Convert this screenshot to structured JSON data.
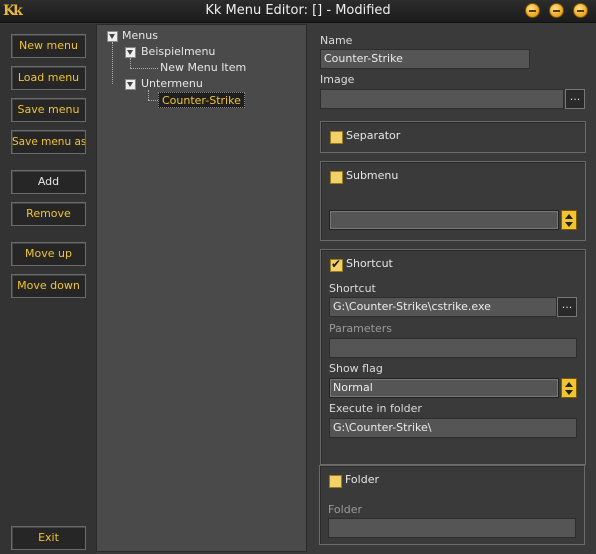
{
  "window": {
    "title": "Kk Menu Editor: [] - Modified",
    "logo": "Kk",
    "controls": [
      "minimize-icon",
      "maximize-icon",
      "close-icon"
    ]
  },
  "sidebar": {
    "new_menu": "New menu",
    "load_menu": "Load menu",
    "save_menu": "Save menu",
    "save_menu_as": "Save menu as",
    "add": "Add",
    "remove": "Remove",
    "move_up": "Move up",
    "move_down": "Move down",
    "exit": "Exit"
  },
  "tree": {
    "root": "Menus",
    "beispielmenu": "Beispielmenu",
    "new_menu_item": "New Menu Item",
    "untermenu": "Untermenu",
    "counter_strike": "Counter-Strike"
  },
  "properties": {
    "name_label": "Name",
    "name_value": "Counter-Strike",
    "image_label": "Image",
    "image_value": "",
    "browse": "...",
    "separator_label": "Separator",
    "submenu_label": "Submenu",
    "submenu_value": "",
    "shortcut_check_label": "Shortcut",
    "shortcut_label": "Shortcut",
    "shortcut_value": "G:\\Counter-Strike\\cstrike.exe",
    "parameters_label": "Parameters",
    "parameters_value": "",
    "show_flag_label": "Show flag",
    "show_flag_value": "Normal",
    "execute_label": "Execute in folder",
    "execute_value": "G:\\Counter-Strike\\",
    "folder_check_label": "Folder",
    "folder_label": "Folder",
    "folder_value": ""
  },
  "state": {
    "separator_checked": false,
    "submenu_checked": false,
    "shortcut_checked": true,
    "folder_checked": false
  },
  "colors": {
    "accent": "#f2c431",
    "background": "#3a3a3a",
    "tree_background": "#4a4a4a"
  }
}
